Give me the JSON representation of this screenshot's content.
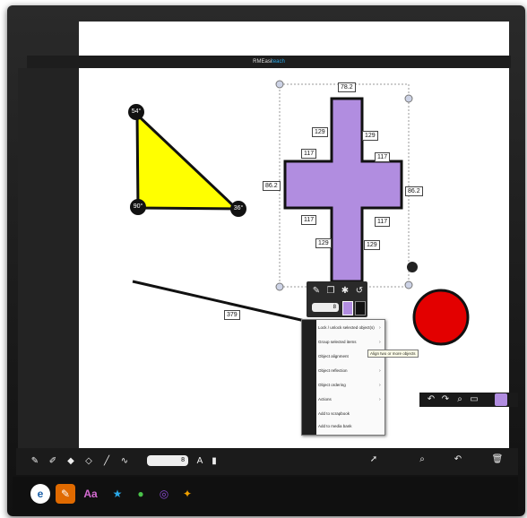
{
  "app": {
    "title_prefix": "RM",
    "title_main": "Easi",
    "title_suffix": "teach"
  },
  "shapes": {
    "triangle_angles": [
      "54°",
      "90°",
      "36°"
    ],
    "cross_labels": {
      "top": "78.2",
      "left": "86.2",
      "right": "86.2",
      "inner": [
        "129",
        "129",
        "117",
        "117",
        "117",
        "117",
        "129",
        "129"
      ]
    },
    "line_label": "379"
  },
  "context_menu": {
    "items": [
      {
        "label": "Lock / unlock selected object(s)",
        "submenu": true
      },
      {
        "label": "Group selected items",
        "submenu": true
      },
      {
        "label": "Object alignment",
        "submenu": true
      },
      {
        "label": "Object reflection",
        "submenu": true
      },
      {
        "label": "Object ordering",
        "submenu": true
      },
      {
        "label": "Actions",
        "submenu": true
      },
      {
        "label": "Add to scrapbook",
        "submenu": false
      },
      {
        "label": "Add to media bank",
        "submenu": false
      }
    ],
    "tooltip": "Align two or more objects"
  },
  "object_toolbar": {
    "width_value": "8"
  },
  "pen_toolbar": {
    "width_value": "8"
  },
  "colors": {
    "purple": "#b18de0",
    "yellow": "#ffff00",
    "red": "#e30000",
    "accent": "#2aa8e8"
  },
  "icons": [
    "home-icon",
    "pen-icon",
    "highlighter-icon",
    "eraser-icon",
    "shapes-icon",
    "text-icon",
    "undo-icon",
    "redo-icon",
    "zoom-icon",
    "trash-icon"
  ]
}
